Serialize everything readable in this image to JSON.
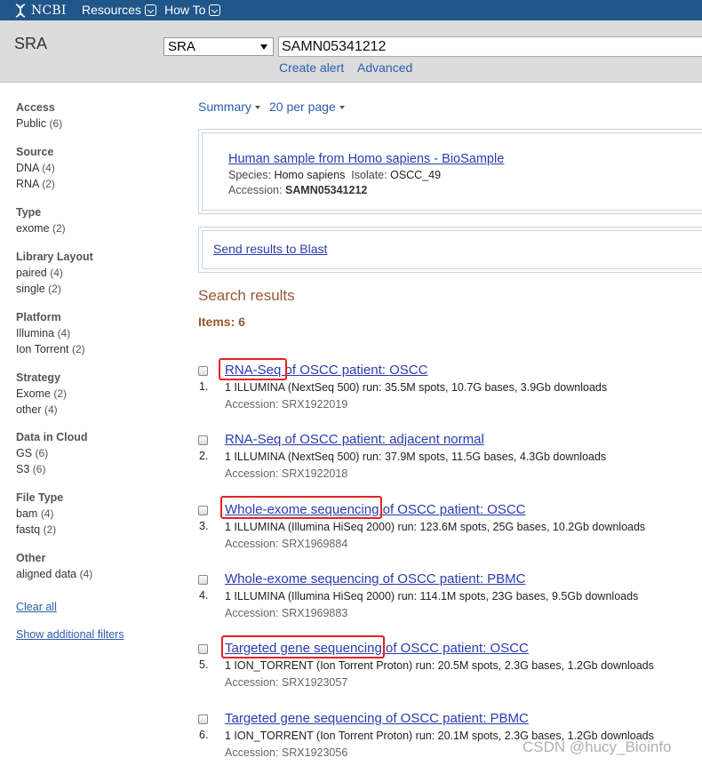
{
  "nav": {
    "logo_text": "NCBI",
    "resources_label": "Resources",
    "howto_label": "How To"
  },
  "search": {
    "db_title": "SRA",
    "db_selected": "SRA",
    "term": "SAMN05341212",
    "create_alert": "Create alert",
    "advanced": "Advanced"
  },
  "sidebar": {
    "facets": [
      {
        "title": "Access",
        "items": [
          {
            "label": "Public",
            "count": "(6)"
          }
        ]
      },
      {
        "title": "Source",
        "items": [
          {
            "label": "DNA",
            "count": "(4)"
          },
          {
            "label": "RNA",
            "count": "(2)"
          }
        ]
      },
      {
        "title": "Type",
        "items": [
          {
            "label": "exome",
            "count": "(2)"
          }
        ]
      },
      {
        "title": "Library Layout",
        "items": [
          {
            "label": "paired",
            "count": "(4)"
          },
          {
            "label": "single",
            "count": "(2)"
          }
        ]
      },
      {
        "title": "Platform",
        "items": [
          {
            "label": "Illumina",
            "count": "(4)"
          },
          {
            "label": "Ion Torrent",
            "count": "(2)"
          }
        ]
      },
      {
        "title": "Strategy",
        "items": [
          {
            "label": "Exome",
            "count": "(2)"
          },
          {
            "label": "other",
            "count": "(4)"
          }
        ]
      },
      {
        "title": "Data in Cloud",
        "items": [
          {
            "label": "GS",
            "count": "(6)"
          },
          {
            "label": "S3",
            "count": "(6)"
          }
        ]
      },
      {
        "title": "File Type",
        "items": [
          {
            "label": "bam",
            "count": "(4)"
          },
          {
            "label": "fastq",
            "count": "(2)"
          }
        ]
      },
      {
        "title": "Other",
        "items": [
          {
            "label": "aligned data",
            "count": "(4)"
          }
        ]
      }
    ],
    "clear_all": "Clear all",
    "show_filters": "Show additional filters"
  },
  "display": {
    "format": "Summary",
    "per_page": "20 per page"
  },
  "sensor": {
    "title": "Human sample from Homo sapiens - BioSample",
    "species_label": "Species:",
    "species_value": "Homo sapiens",
    "isolate_label": "Isolate:",
    "isolate_value": "OSCC_49",
    "accession_label": "Accession:",
    "accession_value": "SAMN05341212"
  },
  "blast": {
    "label": "Send results to Blast"
  },
  "results": {
    "heading": "Search results",
    "items_label": "Items: 6",
    "list": [
      {
        "num": "1.",
        "title": "RNA-Seq of OSCC patient: OSCC",
        "supp": "1 ILLUMINA (NextSeq 500) run: 35.5M spots, 10.7G bases, 3.9Gb downloads",
        "acc": "Accession: SRX1922019"
      },
      {
        "num": "2.",
        "title": "RNA-Seq of OSCC patient: adjacent normal",
        "supp": "1 ILLUMINA (NextSeq 500) run: 37.9M spots, 11.5G bases, 4.3Gb downloads",
        "acc": "Accession: SRX1922018"
      },
      {
        "num": "3.",
        "title": "Whole-exome sequencing of OSCC patient: OSCC",
        "supp": "1 ILLUMINA (Illumina HiSeq 2000) run: 123.6M spots, 25G bases, 10.2Gb downloads",
        "acc": "Accession: SRX1969884"
      },
      {
        "num": "4.",
        "title": "Whole-exome sequencing of OSCC patient: PBMC",
        "supp": "1 ILLUMINA (Illumina HiSeq 2000) run: 114.1M spots, 23G bases, 9.5Gb downloads",
        "acc": "Accession: SRX1969883"
      },
      {
        "num": "5.",
        "title": "Targeted gene sequencing of OSCC patient: OSCC",
        "supp": "1 ION_TORRENT (Ion Torrent Proton) run: 20.5M spots, 2.3G bases, 1.2Gb downloads",
        "acc": "Accession: SRX1923057"
      },
      {
        "num": "6.",
        "title": "Targeted gene sequencing of OSCC patient: PBMC",
        "supp": "1 ION_TORRENT (Ion Torrent Proton) run: 20.1M spots, 2.3G bases, 1.2Gb downloads",
        "acc": "Accession: SRX1923056"
      }
    ]
  },
  "watermark": "CSDN @hucy_Bioinfo"
}
